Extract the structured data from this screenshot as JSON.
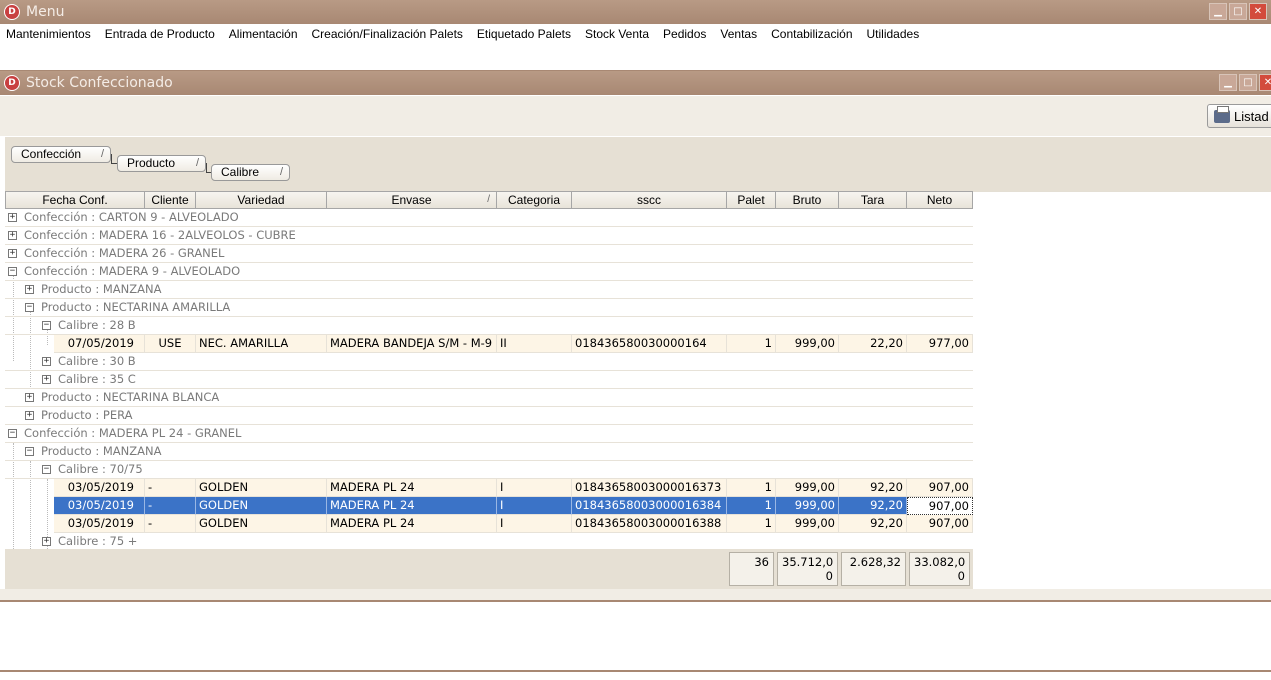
{
  "app": {
    "title": "Menu"
  },
  "menu": [
    "Mantenimientos",
    "Entrada de Producto",
    "Alimentación",
    "Creación/Finalización Palets",
    "Etiquetado Palets",
    "Stock Venta",
    "Pedidos",
    "Ventas",
    "Contabilización",
    "Utilidades"
  ],
  "window": {
    "title": "Stock Confeccionado"
  },
  "toolbar": {
    "list_label": "Listad"
  },
  "grouping": [
    "Confección",
    "Producto",
    "Calibre"
  ],
  "columns": [
    "Fecha Conf.",
    "Cliente",
    "Variedad",
    "Envase",
    "Categoria",
    "sscc",
    "Palet",
    "Bruto",
    "Tara",
    "Neto"
  ],
  "groups": [
    {
      "label": "Confección : CARTON 9 - ALVEOLADO"
    },
    {
      "label": "Confección : MADERA 16 - 2ALVEOLOS - CUBRE"
    },
    {
      "label": "Confección : MADERA 26 - GRANEL"
    },
    {
      "label": "Confección : MADERA 9 - ALVEOLADO"
    },
    {
      "label": "Producto : MANZANA"
    },
    {
      "label": "Producto : NECTARINA AMARILLA"
    },
    {
      "label": "Calibre : 28 B"
    },
    {
      "label": "Calibre : 30 B"
    },
    {
      "label": "Calibre : 35 C"
    },
    {
      "label": "Producto : NECTARINA BLANCA"
    },
    {
      "label": "Producto : PERA"
    },
    {
      "label": "Confección : MADERA PL 24 - GRANEL"
    },
    {
      "label": "Producto : MANZANA"
    },
    {
      "label": "Calibre : 70/75"
    },
    {
      "label": "Calibre : 75 +"
    }
  ],
  "rows": [
    [
      "07/05/2019",
      "USE",
      "NEC. AMARILLA",
      "MADERA BANDEJA S/M - M-9",
      "II",
      "018436580030000164",
      "1",
      "999,00",
      "22,20",
      "977,00"
    ],
    [
      "03/05/2019",
      "-",
      "GOLDEN",
      "MADERA PL 24",
      "I",
      "01843658003000016373",
      "1",
      "999,00",
      "92,20",
      "907,00"
    ],
    [
      "03/05/2019",
      "-",
      "GOLDEN",
      "MADERA PL 24",
      "I",
      "01843658003000016384",
      "1",
      "999,00",
      "92,20",
      "907,00"
    ],
    [
      "03/05/2019",
      "-",
      "GOLDEN",
      "MADERA PL 24",
      "I",
      "01843658003000016388",
      "1",
      "999,00",
      "92,20",
      "907,00"
    ]
  ],
  "totals": {
    "palet": "36",
    "bruto_1": "35.712,0",
    "bruto_2": "0",
    "tara": "2.628,32",
    "neto_1": "33.082,0",
    "neto_2": "0"
  },
  "colors": {
    "titlebar": "#a88873",
    "selection": "#3b73c7",
    "row_bg": "#fdf5e6",
    "panel": "#e6e0d4"
  }
}
